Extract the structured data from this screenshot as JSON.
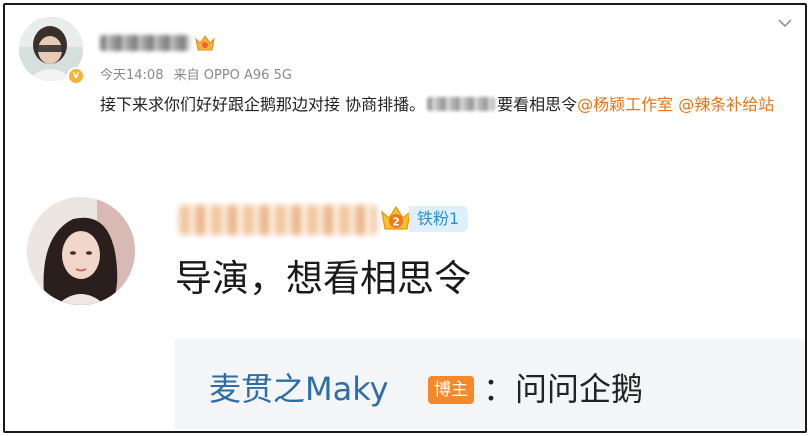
{
  "post": {
    "timestamp": "今天14:08",
    "source": "来自 OPPO A96 5G",
    "text_before": "接下来求你们好好跟企鹅那边对接 协商排播。",
    "text_after": "要看相思令",
    "mention_1": "@杨颖工作室",
    "mention_2": "@辣条补给站"
  },
  "comment": {
    "fan_badge": "铁粉1",
    "crown_level": "2",
    "text": "导演，想看相思令"
  },
  "reply": {
    "author": "麦贯之Maky",
    "host_badge": "博主",
    "text": "：问问企鹅"
  },
  "colors": {
    "mention": "#e8751a",
    "fan_badge_bg": "#dff0fb",
    "fan_badge_text": "#2c8fd3",
    "reply_author": "#2e6ea6",
    "host_badge_bg": "#f4892b"
  },
  "icons": {
    "verified": "verified-badge-icon",
    "member_crown": "member-crown-icon",
    "fan_crown": "fan-crown-icon",
    "more": "chevron-down-icon"
  }
}
